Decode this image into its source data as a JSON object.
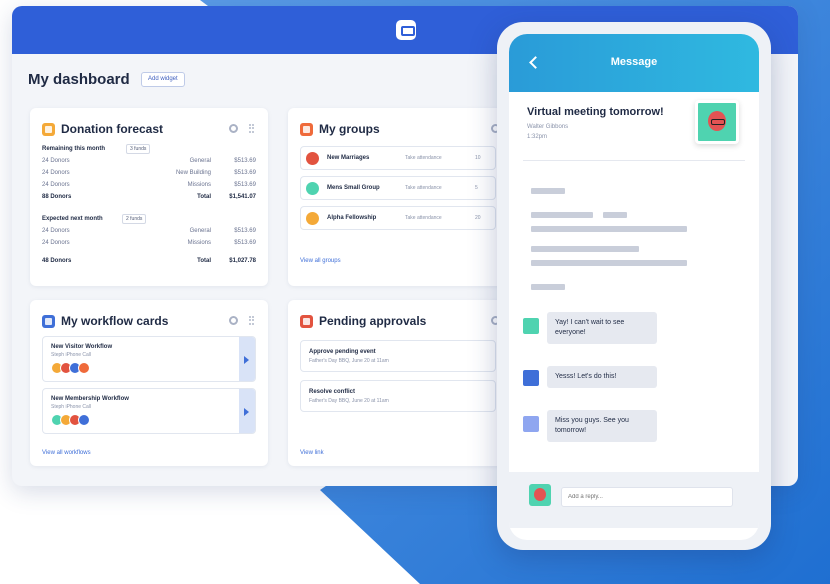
{
  "colors": {
    "brand_blue": "#2f5fd8",
    "phone_header": "#2fa9dc",
    "link": "#3f6fd8"
  },
  "dashboard": {
    "title": "My dashboard",
    "add_widget": "Add widget"
  },
  "donation": {
    "title": "Donation forecast",
    "icon": "donation-icon",
    "remaining_label": "Remaining this month",
    "remaining_badge": "3 funds",
    "remaining_rows": [
      {
        "donors": "24 Donors",
        "fund": "General",
        "amount": "$513.69"
      },
      {
        "donors": "24 Donors",
        "fund": "New Building",
        "amount": "$513.69"
      },
      {
        "donors": "24 Donors",
        "fund": "Missions",
        "amount": "$513.69"
      }
    ],
    "remaining_total": {
      "donors": "88 Donors",
      "label": "Total",
      "amount": "$1,541.07"
    },
    "expected_label": "Expected next month",
    "expected_badge": "2 funds",
    "expected_rows": [
      {
        "donors": "24 Donors",
        "fund": "General",
        "amount": "$513.69"
      },
      {
        "donors": "24 Donors",
        "fund": "Missions",
        "amount": "$513.69"
      }
    ],
    "expected_total": {
      "donors": "48 Donors",
      "label": "Total",
      "amount": "$1,027.78"
    }
  },
  "groups": {
    "title": "My groups",
    "items": [
      {
        "name": "New Marriages",
        "action": "Take attendance",
        "count": "10"
      },
      {
        "name": "Mens Small Group",
        "action": "Take attendance",
        "count": "5"
      },
      {
        "name": "Alpha Fellowship",
        "action": "Take attendance",
        "count": "20"
      }
    ],
    "view_all": "View all groups"
  },
  "workflow": {
    "title": "My workflow cards",
    "items": [
      {
        "title": "New Visitor Workflow",
        "sub": "Steph iPhone Call"
      },
      {
        "title": "New Membership Workflow",
        "sub": "Steph iPhone Call"
      }
    ],
    "view_all": "View all workflows"
  },
  "approvals": {
    "title": "Pending approvals",
    "items": [
      {
        "title": "Approve pending event",
        "sub": "Father's Day BBQ, June 20 at 11am"
      },
      {
        "title": "Resolve conflict",
        "sub": "Father's Day BBQ, June 20 at 11am"
      }
    ],
    "view_link": "View link"
  },
  "phone": {
    "header_title": "Message",
    "message_title": "Virtual meeting tomorrow!",
    "author": "Walter Gibbons",
    "time": "1:32pm",
    "chats": [
      {
        "text": "Yay! I can't wait to see everyone!"
      },
      {
        "text": "Yesss! Let's do this!"
      },
      {
        "text": "Miss you guys. See you tomorrow!"
      }
    ],
    "reply_placeholder": "Add a reply..."
  }
}
